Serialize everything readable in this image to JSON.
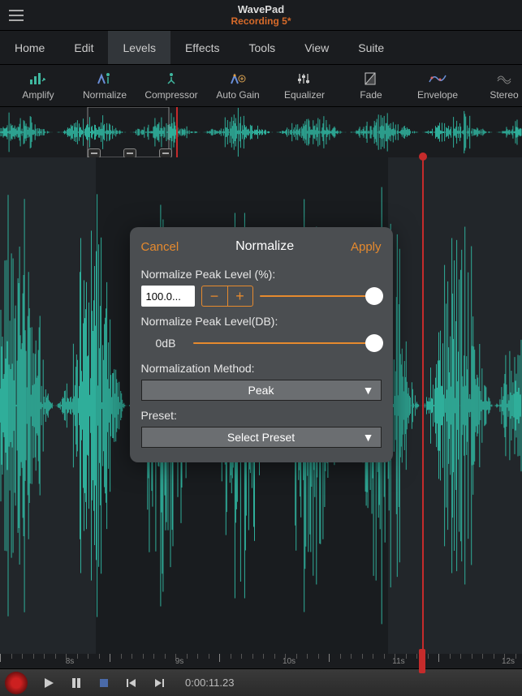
{
  "header": {
    "app_name": "WavePad",
    "document": "Recording 5*"
  },
  "tabs": [
    {
      "label": "Home",
      "active": false
    },
    {
      "label": "Edit",
      "active": false
    },
    {
      "label": "Levels",
      "active": true
    },
    {
      "label": "Effects",
      "active": false
    },
    {
      "label": "Tools",
      "active": false
    },
    {
      "label": "View",
      "active": false
    },
    {
      "label": "Suite",
      "active": false
    }
  ],
  "toolbar": [
    {
      "label": "Amplify",
      "icon": "amplify-icon"
    },
    {
      "label": "Normalize",
      "icon": "normalize-icon"
    },
    {
      "label": "Compressor",
      "icon": "compressor-icon"
    },
    {
      "label": "Auto Gain",
      "icon": "autogain-icon"
    },
    {
      "label": "Equalizer",
      "icon": "equalizer-icon"
    },
    {
      "label": "Fade",
      "icon": "fade-icon"
    },
    {
      "label": "Envelope",
      "icon": "envelope-icon"
    },
    {
      "label": "Stereo",
      "icon": "stereo-icon"
    }
  ],
  "timeline": {
    "ticks": [
      "8s",
      "9s",
      "10s",
      "11s",
      "12s"
    ]
  },
  "transport": {
    "timecode": "0:00:11.23"
  },
  "dialog": {
    "title": "Normalize",
    "cancel": "Cancel",
    "apply": "Apply",
    "peak_pct_label": "Normalize Peak Level (%):",
    "peak_pct_value": "100.0...",
    "peak_db_label": "Normalize Peak Level(DB):",
    "peak_db_value": "0dB",
    "method_label": "Normalization Method:",
    "method_value": "Peak",
    "preset_label": "Preset:",
    "preset_value": "Select Preset"
  },
  "colors": {
    "accent": "#e68a2e",
    "waveform": "#2fae9a",
    "playhead": "#c52b2b"
  },
  "icons": {
    "hamburger": "menu-icon",
    "play": "play-icon",
    "pause": "pause-icon",
    "stop": "stop-icon",
    "prev": "skip-back-icon",
    "next": "skip-forward-icon",
    "record": "record-icon",
    "minus": "−",
    "plus": "+",
    "caret": "▼"
  }
}
